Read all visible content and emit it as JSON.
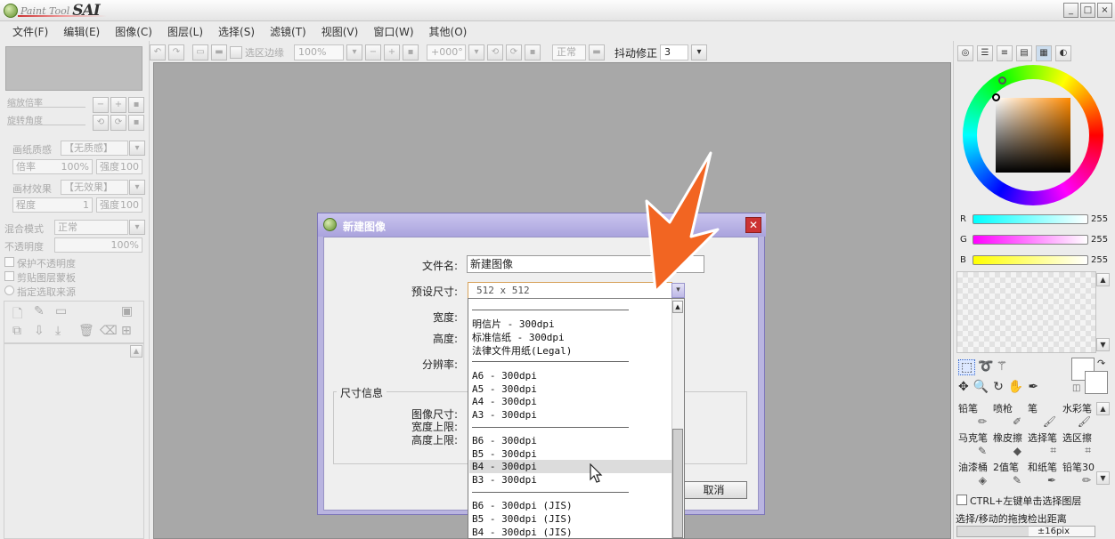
{
  "app": {
    "title_small": "Paint Tool",
    "title_big": "SAI"
  },
  "window_buttons": [
    "_",
    "□",
    "×"
  ],
  "menu": [
    "文件(F)",
    "编辑(E)",
    "图像(C)",
    "图层(L)",
    "选择(S)",
    "滤镜(T)",
    "视图(V)",
    "窗口(W)",
    "其他(O)"
  ],
  "toolbar": {
    "select_edge_label": "选区边缘",
    "zoom": "100%",
    "rotation": "+000°",
    "mode": "正常",
    "stabilizer_label": "抖动修正",
    "stabilizer_value": "3"
  },
  "left_panel": {
    "zoom_label": "缩放倍率",
    "rotate_label": "旋转角度",
    "paper_texture_label": "画纸质感",
    "paper_texture_value": "【无质感】",
    "scale_label": "倍率",
    "scale_value": "100%",
    "strength_label": "强度",
    "strength_value": "100",
    "paper_effect_label": "画材效果",
    "paper_effect_value": "【无效果】",
    "degree_label": "程度",
    "degree_value": "1",
    "strength2_label": "强度",
    "strength2_value": "100",
    "blend_label": "混合模式",
    "blend_value": "正常",
    "opacity_label": "不透明度",
    "opacity_value": "100%",
    "protect_opacity": "保护不透明度",
    "clip_group": "剪贴图层蒙板",
    "selection_source": "指定选取来源"
  },
  "dialog": {
    "title": "新建图像",
    "filename_label": "文件名:",
    "filename_value": "新建图像",
    "preset_label": "预设尺寸:",
    "preset_value": "512 x  512",
    "width_label": "宽度:",
    "height_label": "高度:",
    "resolution_label": "分辨率:",
    "size_info_label": "尺寸信息",
    "image_size_label": "图像尺寸:",
    "width_limit_label": "宽度上限:",
    "height_limit_label": "高度上限:",
    "cancel_label": "取消",
    "options": [
      "明信片 - 300dpi",
      "标准信纸 - 300dpi",
      "法律文件用纸(Legal)",
      "A6 - 300dpi",
      "A5 - 300dpi",
      "A4 - 300dpi",
      "A3 - 300dpi",
      "B6 - 300dpi",
      "B5 - 300dpi",
      "B4 - 300dpi",
      "B3 - 300dpi",
      "B6 - 300dpi (JIS)",
      "B5 - 300dpi (JIS)",
      "B4 - 300dpi (JIS)"
    ],
    "highlighted_option": "B4 - 300dpi"
  },
  "right_panel": {
    "r_label": "R",
    "r_value": "255",
    "g_label": "G",
    "g_value": "255",
    "b_label": "B",
    "b_value": "255",
    "tools": [
      "铅笔",
      "喷枪",
      "笔",
      "水彩笔",
      "马克笔",
      "橡皮擦",
      "选择笔",
      "选区擦",
      "油漆桶",
      "2值笔",
      "和纸笔",
      "铅笔30"
    ],
    "ctrl_checkbox": "CTRL+左键单击选择图层",
    "drag_label": "选择/移动的拖拽检出距离",
    "drag_value": "±16pix"
  },
  "colors": {
    "accent_arrow": "#f26522",
    "dialog_frame": "#b9b4e0",
    "close_red": "#cc3333"
  }
}
